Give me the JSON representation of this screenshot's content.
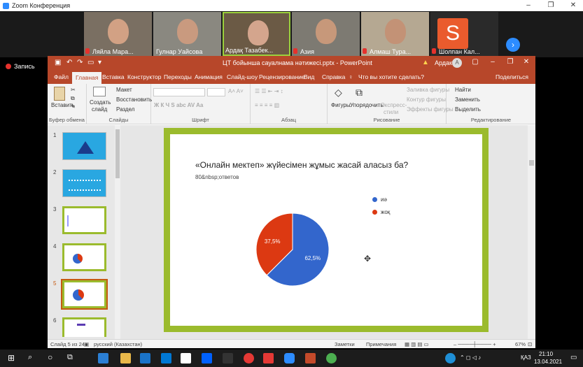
{
  "zoom": {
    "title": "Zoom Конференция",
    "window_controls": [
      "–",
      "❐",
      "✕"
    ],
    "participants": [
      {
        "name": "Ляйла Мара..."
      },
      {
        "name": "Гулнар Уайсова"
      },
      {
        "name": "Ардақ Тазабек..."
      },
      {
        "name": "Азия"
      },
      {
        "name": "Алмаш Тура..."
      },
      {
        "name": "Шолпан Кал...",
        "initial": "S"
      }
    ],
    "record_label": "Запись"
  },
  "ppt": {
    "doc_title": "ЦТ бойынша сауалнама нәтижесі.pptx - PowerPoint",
    "user": "Ардак",
    "user_initial": "A",
    "tabs": [
      "Файл",
      "Главная",
      "Вставка",
      "Конструктор",
      "Переходы",
      "Анимация",
      "Слайд-шоу",
      "Рецензирование",
      "Вид",
      "Справка",
      "Что вы хотите сделать?"
    ],
    "share": "Поделиться",
    "ribbon": {
      "paste": "Вставить",
      "clipboard": "Буфер обмена",
      "create": "Создать",
      "slide": "слайд",
      "layout": "Макет",
      "reset": "Восстановить",
      "section": "Раздел",
      "slides_group": "Слайды",
      "font_group": "Шрифт",
      "paragraph_group": "Абзац",
      "shapes": "Фигуры",
      "arrange": "Упорядочить",
      "express": "Экспресс-",
      "styles": "стили",
      "fill": "Заливка фигуры",
      "outline": "Контур фигуры",
      "effects": "Эффекты фигуры",
      "drawing_group": "Рисование",
      "find": "Найти",
      "replace": "Заменить",
      "select": "Выделить",
      "editing_group": "Редактирование"
    },
    "thumbnails": [
      "1",
      "2",
      "3",
      "4",
      "5",
      "6"
    ],
    "slide": {
      "title": "«Онлайн мектеп» жүйесімен жұмыс жасай аласыз ба?",
      "subtitle": "80&nbsp;ответов"
    },
    "status": {
      "slide_of": "Слайд 5 из 24",
      "language": "русский (Казахстан)",
      "notes": "Заметки",
      "comments": "Примечания",
      "zoom": "67%"
    }
  },
  "chart_data": {
    "type": "pie",
    "categories": [
      "иә",
      "жоқ"
    ],
    "values": [
      62.5,
      37.5
    ],
    "labels": [
      "62,5%",
      "37,5%"
    ],
    "colors": [
      "#3366cc",
      "#dc3912"
    ],
    "legend_position": "right"
  },
  "taskbar": {
    "time": "21:10",
    "date": "13.04.2021",
    "lang": "ҚАЗ"
  }
}
